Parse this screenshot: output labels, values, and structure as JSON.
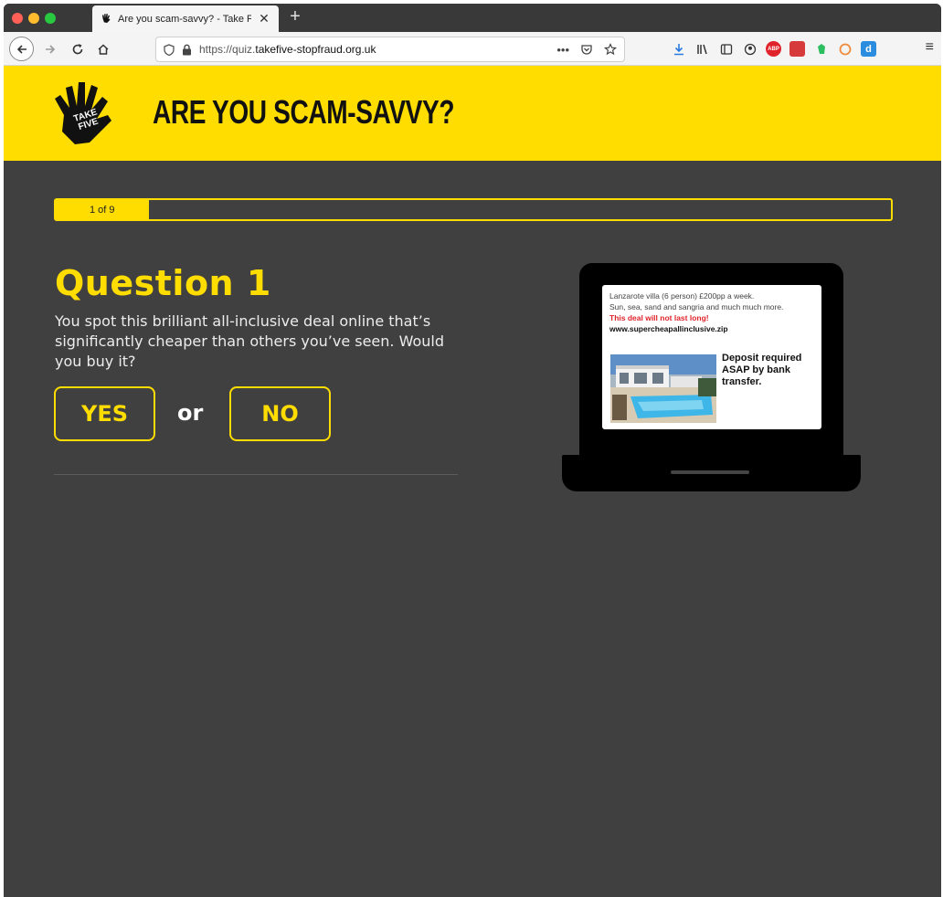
{
  "browser": {
    "tab_title": "Are you scam-savvy? - Take Fi",
    "tab_close": "✕",
    "new_tab": "+",
    "url_prefix": "https://quiz.",
    "url_domain": "takefive-stopfraud.org.uk",
    "url_more": "•••"
  },
  "header": {
    "logo_text_top": "TAKE",
    "logo_text_bottom": "FIVE",
    "title": "ARE YOU SCAM-SAVVY?",
    "bg_color": "#ffdd00"
  },
  "progress": {
    "label": "1 of 9",
    "current": 1,
    "total": 9
  },
  "question": {
    "heading": "Question 1",
    "text": "You spot this brilliant all-inclusive deal online that’s significantly cheaper than others you’ve seen. Would you buy it?",
    "yes_label": "YES",
    "or_label": "or",
    "no_label": "NO"
  },
  "ad": {
    "line1": "Lanzarote villa (6 person) £200pp a week.",
    "line2": "Sun, sea, sand and sangria and much much more.",
    "warning": "This deal will not last long!",
    "url": "www.supercheapallinclusive.zip",
    "deposit": "Deposit required ASAP by bank transfer."
  },
  "colors": {
    "accent": "#ffdd00",
    "background": "#404040",
    "warning": "#e0232a"
  }
}
